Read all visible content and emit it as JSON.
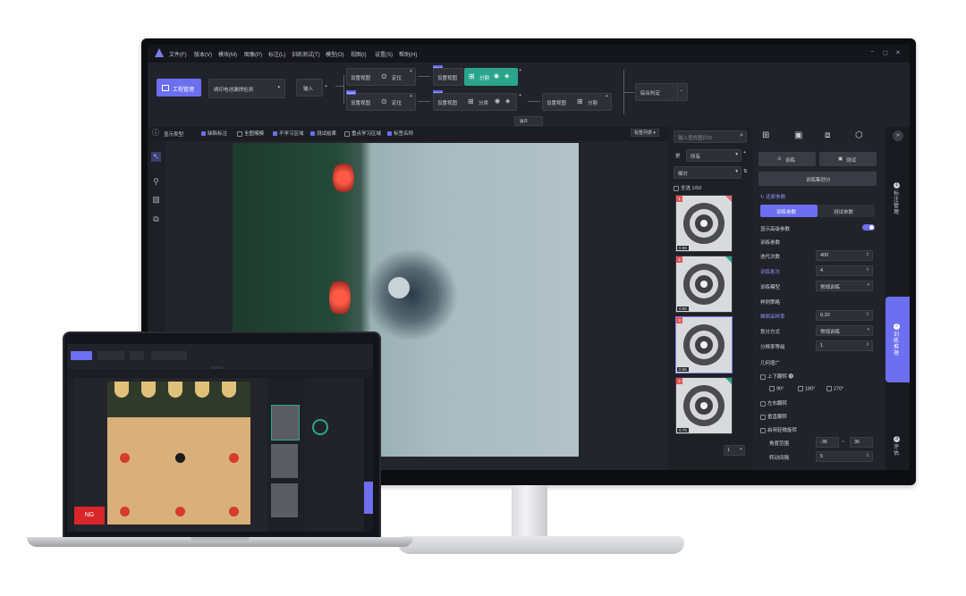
{
  "menu": [
    "文件(F)",
    "版本(V)",
    "模块(M)",
    "图像(P)",
    "标注(L)",
    "训练测试(T)",
    "模型(O)",
    "视图(I)",
    "设置(S)",
    "帮助(H)"
  ],
  "window_controls": [
    "−",
    "◻",
    "✕"
  ],
  "toolbar": {
    "project_button": "工程管理",
    "project_name": "绣印电池漏焊检测",
    "input_node": "输入",
    "nodes": [
      "设置视图",
      "定位",
      "设置视图",
      "分割",
      "设置视图",
      "定位",
      "设置视图",
      "分类",
      "设置视图",
      "分割"
    ],
    "input_tag": "Input",
    "final_node": "综合判定",
    "expand_label": "展开"
  },
  "display_row": {
    "label": "显示类型:",
    "options": [
      {
        "label": "缺陷标注",
        "checked": true
      },
      {
        "label": "全图掩模",
        "checked": false
      },
      {
        "label": "不学习区域",
        "checked": true
      },
      {
        "label": "测试结果",
        "checked": true
      },
      {
        "label": "重点学习区域",
        "checked": false
      },
      {
        "label": "标签名称",
        "checked": true
      }
    ],
    "tag_list": "标签列表"
  },
  "thumbs": {
    "search_placeholder": "输入查找图片ID",
    "filter_label": "所有",
    "filter_prefix": "是",
    "type_label": "细分",
    "select_all": "全选",
    "count": "1/50",
    "scores": [
      "0.86",
      "0.86",
      "0.86",
      "0.79"
    ],
    "page": "1"
  },
  "right_panel": {
    "train_button": "训练",
    "test_button": "测试",
    "train_set_button": "训练集划分",
    "back_params": "还原参数",
    "tab_train": "训练参数",
    "tab_test": "测试参数",
    "show_advanced": "显示高级参数",
    "section_train": "训练参数",
    "rows": [
      {
        "label": "迭代次数",
        "value": "400",
        "blue": false
      },
      {
        "label": "训练批次",
        "value": "4",
        "blue": true
      },
      {
        "label": "训练模型",
        "value": "常规训练",
        "blue": false
      }
    ],
    "section_sample": "样例策略",
    "sample_rows": [
      {
        "label": "维倒采样率",
        "value": "0.20",
        "blue": true
      },
      {
        "label": "划分方式",
        "value": "常规训练",
        "blue": false
      },
      {
        "label": "分辨率等级",
        "value": "1",
        "blue": false
      }
    ],
    "section_geo": "几何增广",
    "flip_ud": "上下翻转",
    "angles": [
      "90°",
      "180°",
      "270°"
    ],
    "flip_lr": "左右翻转",
    "flip_v": "垂直翻转",
    "slight_rotate": "启用轻微旋转",
    "angle_range_label": "角度范围",
    "angle_min": "-36",
    "angle_max": "36",
    "rotate_step_label": "转动间隔",
    "rotate_step": "5"
  },
  "side_tabs": [
    {
      "num": "1",
      "label": "标注管理"
    },
    {
      "num": "2",
      "label": "训练推理"
    },
    {
      "num": "3",
      "label": "评估"
    }
  ],
  "laptop": {
    "ng_label": "NG"
  },
  "colors": {
    "accent": "#6b6ff0",
    "green": "#2aa58b",
    "ng": "#d8262a"
  }
}
